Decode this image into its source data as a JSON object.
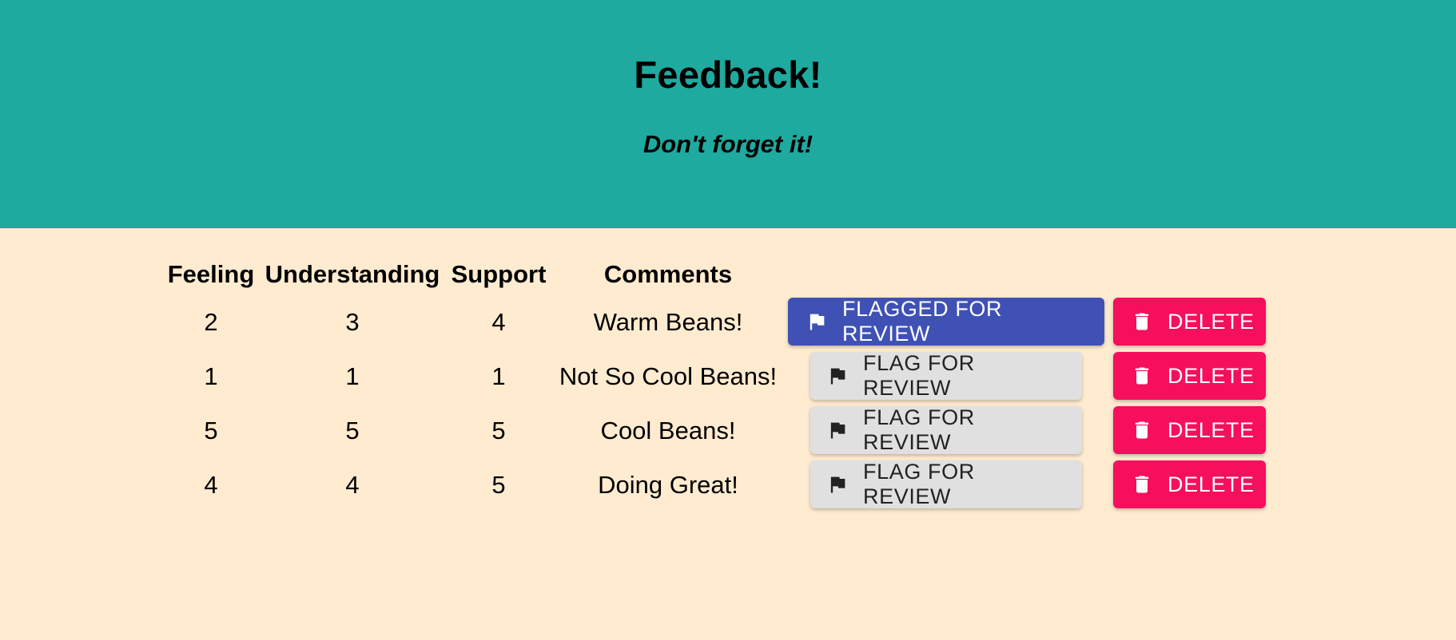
{
  "header": {
    "title": "Feedback!",
    "subtitle": "Don't forget it!"
  },
  "table": {
    "columns": [
      "Feeling",
      "Understanding",
      "Support",
      "Comments"
    ],
    "rows": [
      {
        "feeling": "2",
        "understanding": "3",
        "support": "4",
        "comment": "Warm Beans!",
        "flag_label": "FLAGGED FOR REVIEW",
        "flagged": true,
        "delete_label": "DELETE"
      },
      {
        "feeling": "1",
        "understanding": "1",
        "support": "1",
        "comment": "Not So Cool Beans!",
        "flag_label": "FLAG FOR REVIEW",
        "flagged": false,
        "delete_label": "DELETE"
      },
      {
        "feeling": "5",
        "understanding": "5",
        "support": "5",
        "comment": "Cool Beans!",
        "flag_label": "FLAG FOR REVIEW",
        "flagged": false,
        "delete_label": "DELETE"
      },
      {
        "feeling": "4",
        "understanding": "4",
        "support": "5",
        "comment": "Doing Great!",
        "flag_label": "FLAG FOR REVIEW",
        "flagged": false,
        "delete_label": "DELETE"
      }
    ]
  },
  "icons": {
    "flag": "flag-icon",
    "delete": "trash-icon"
  },
  "colors": {
    "header_bg": "#1eaa9f",
    "page_bg": "#ffebd0",
    "flagged_button": "#3f51b5",
    "flag_button": "#e0e0e0",
    "delete_button": "#f50f5d"
  }
}
